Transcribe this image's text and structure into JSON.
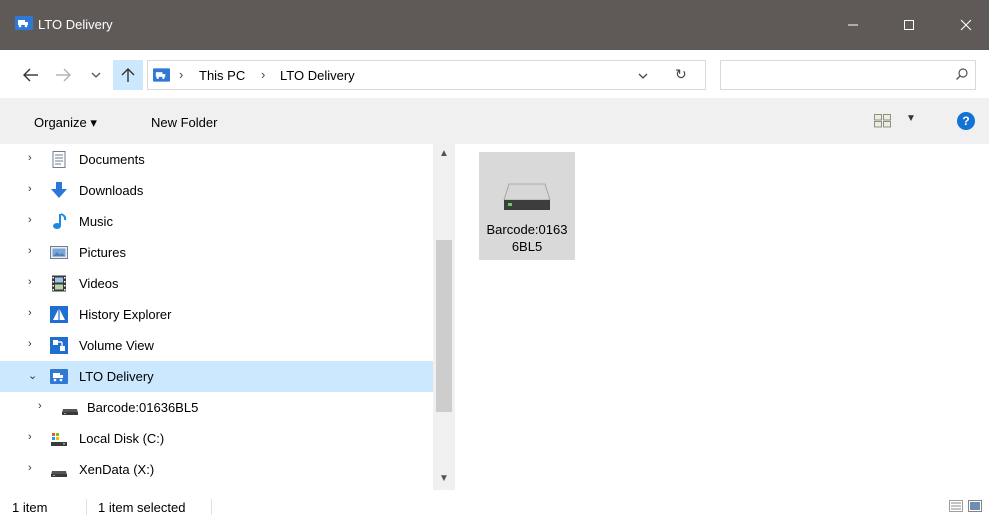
{
  "window": {
    "title": "LTO Delivery",
    "min_glyph": "—",
    "close_glyph": "✕"
  },
  "nav": {
    "back_glyph": "←",
    "forward_glyph": "→",
    "recent_glyph": "⌄",
    "up_glyph": "↑"
  },
  "address": {
    "crumbs": [
      "This PC",
      "LTO Delivery"
    ],
    "separator": "›",
    "dropdown_glyph": "⌄",
    "refresh_glyph": "↻",
    "search_placeholder": ""
  },
  "toolbar": {
    "organize_label": "Organize ▾",
    "new_folder_label": "New Folder",
    "view_drop_glyph": "▼",
    "help_label": "?"
  },
  "sidebar": {
    "items": [
      {
        "label": "Documents",
        "icon": "documents-icon",
        "chevron": "›",
        "selected": false
      },
      {
        "label": "Downloads",
        "icon": "downloads-icon",
        "chevron": "›",
        "selected": false
      },
      {
        "label": "Music",
        "icon": "music-icon",
        "chevron": "›",
        "selected": false
      },
      {
        "label": "Pictures",
        "icon": "pictures-icon",
        "chevron": "›",
        "selected": false
      },
      {
        "label": "Videos",
        "icon": "videos-icon",
        "chevron": "›",
        "selected": false
      },
      {
        "label": "History Explorer",
        "icon": "history-explorer-icon",
        "chevron": "›",
        "selected": false
      },
      {
        "label": "Volume View",
        "icon": "volume-view-icon",
        "chevron": "›",
        "selected": false
      },
      {
        "label": "LTO Delivery",
        "icon": "truck-icon",
        "chevron": "⌄",
        "selected": true
      },
      {
        "label": "Barcode:01636BL5",
        "icon": "drive-icon",
        "chevron": "›",
        "selected": false
      },
      {
        "label": "Local Disk (C:)",
        "icon": "local-disk-icon",
        "chevron": "›",
        "selected": false
      },
      {
        "label": "XenData (X:)",
        "icon": "drive-icon",
        "chevron": "›",
        "selected": false
      }
    ],
    "scroll_up_glyph": "▲",
    "scroll_down_glyph": "▼"
  },
  "content": {
    "items": [
      {
        "label": "Barcode:01636BL5",
        "icon": "drive-icon"
      }
    ]
  },
  "status": {
    "item_count": "1 item",
    "selection": "1 item selected"
  },
  "colors": {
    "titlebar": "#5f5a58",
    "selected": "#cce8ff",
    "accent": "#1273d5"
  }
}
